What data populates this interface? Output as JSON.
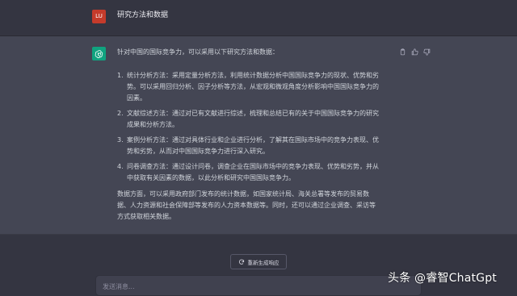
{
  "user": {
    "avatar_text": "LU",
    "message": "研究方法和数据"
  },
  "assistant": {
    "intro": "针对中国的国际竞争力，可以采用以下研究方法和数据：",
    "methods": [
      {
        "num": "1.",
        "lines": [
          "统计分析方法：采用定量分析方法，利用统计数据分析中国国际竞争力的现状、优势和劣",
          "势。可以采用回归分析、因子分析等方法，从宏观和微观角度分析影响中国国际竞争力的",
          "因素。"
        ]
      },
      {
        "num": "2.",
        "lines": [
          "文献综述方法：通过对已有文献进行综述，梳理和总结已有的关于中国国际竞争力的研究",
          "成果和分析方法。"
        ]
      },
      {
        "num": "3.",
        "lines": [
          "案例分析方法：通过对具体行业和企业进行分析，了解其在国际市场中的竞争力表现、优",
          "势和劣势，从而对中国国际竞争力进行深入研究。"
        ]
      },
      {
        "num": "4.",
        "lines": [
          "问卷调查方法：通过设计问卷，调查企业在国际市场中的竞争力表现、优势和劣势，并从",
          "中获取有关因素的数据，以此分析和研究中国国际竞争力。"
        ]
      }
    ],
    "data_lines": [
      "数据方面，可以采用政府部门发布的统计数据，如国家统计局、海关总署等发布的贸易数",
      "据、人力资源和社会保障部等发布的人力资本数据等。同时，还可以通过企业调查、采访等",
      "方式获取相关数据。"
    ]
  },
  "actions": {
    "copy_icon": "clipboard-icon",
    "like_icon": "thumbs-up-icon",
    "dislike_icon": "thumbs-down-icon"
  },
  "regenerate": {
    "label": "重新生成响应",
    "icon": "refresh-icon"
  },
  "input": {
    "placeholder": "发送消息..."
  },
  "watermark": {
    "text": "头条 @睿智ChatGpt"
  },
  "colors": {
    "background": "#343541",
    "assistant_background": "#444654",
    "gpt_green": "#10a37f",
    "user_avatar": "#c53b2b"
  }
}
